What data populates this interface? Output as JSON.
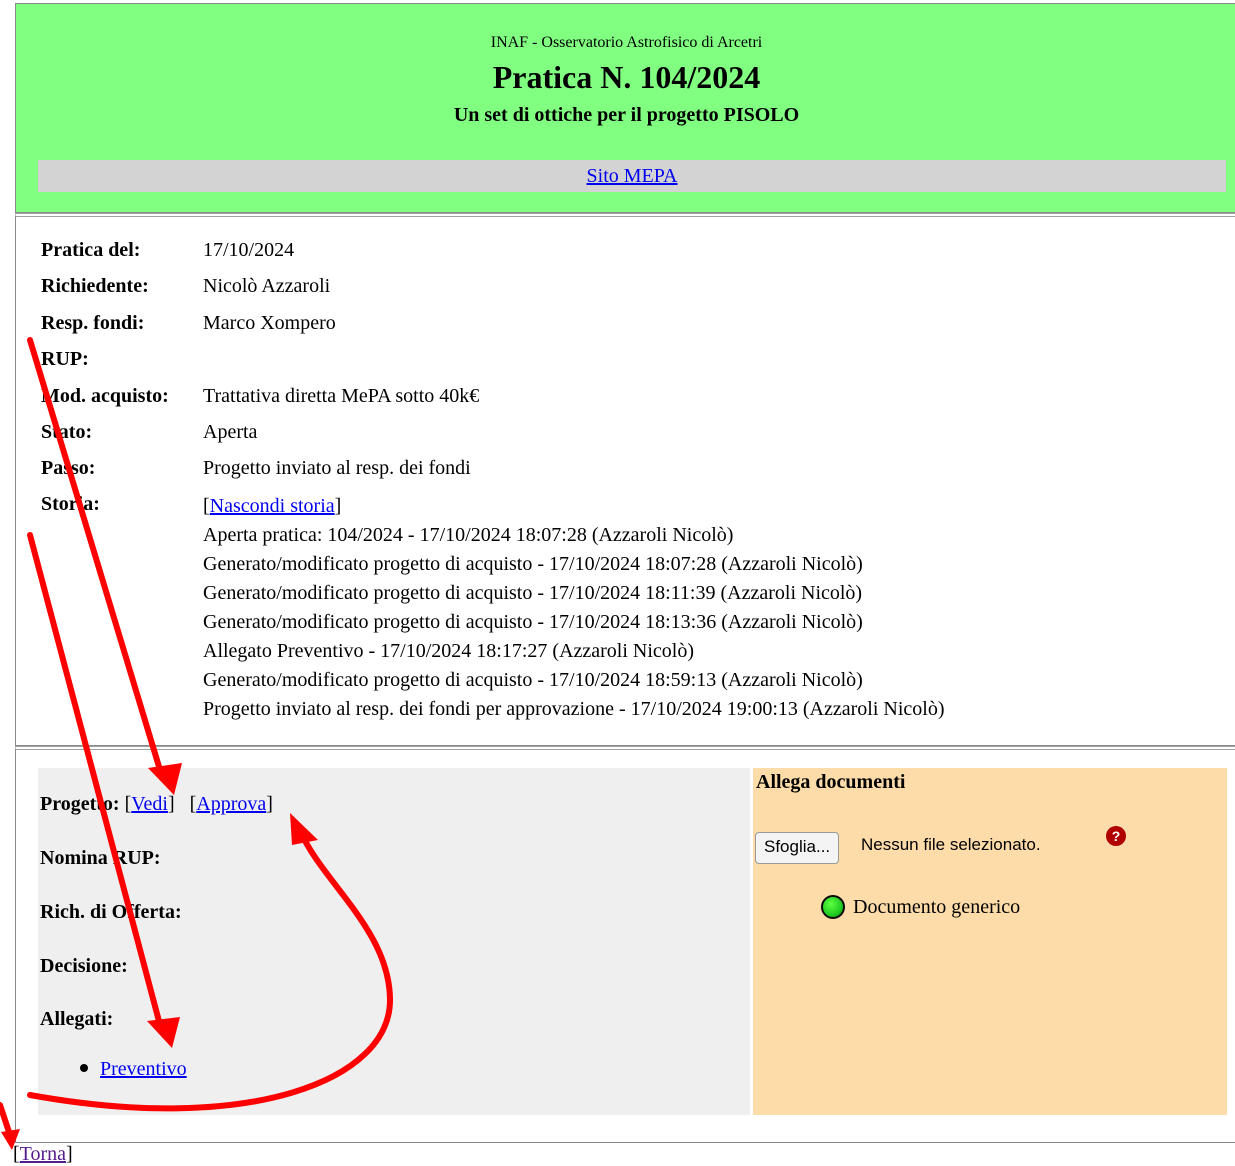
{
  "header": {
    "institution": "INAF - Osservatorio Astrofisico di Arcetri",
    "title": "Pratica N. 104/2024",
    "subtitle": "Un set di ottiche per il progetto PISOLO",
    "mepa_link": "Sito MEPA"
  },
  "info": {
    "fields": [
      {
        "label": "Pratica del:",
        "value": "17/10/2024"
      },
      {
        "label": "Richiedente:",
        "value": "Nicolò Azzaroli"
      },
      {
        "label": "Resp. fondi:",
        "value": "Marco Xompero"
      },
      {
        "label": "RUP:",
        "value": ""
      },
      {
        "label": "Mod. acquisto:",
        "value": "Trattativa diretta MePA sotto 40k€"
      },
      {
        "label": "Stato:",
        "value": "Aperta"
      },
      {
        "label": "Passo:",
        "value": "Progetto inviato al resp. dei fondi"
      },
      {
        "label": "Storia:",
        "value": ""
      }
    ],
    "history_toggle": "Nascondi storia",
    "history": [
      "Aperta pratica: 104/2024 - 17/10/2024 18:07:28 (Azzaroli Nicolò)",
      "Generato/modificato progetto di acquisto - 17/10/2024 18:07:28 (Azzaroli Nicolò)",
      "Generato/modificato progetto di acquisto - 17/10/2024 18:11:39 (Azzaroli Nicolò)",
      "Generato/modificato progetto di acquisto - 17/10/2024 18:13:36 (Azzaroli Nicolò)",
      "Allegato Preventivo - 17/10/2024 18:17:27 (Azzaroli Nicolò)",
      "Generato/modificato progetto di acquisto - 17/10/2024 18:59:13 (Azzaroli Nicolò)",
      "Progetto inviato al resp. dei fondi per approvazione - 17/10/2024 19:00:13 (Azzaroli Nicolò)"
    ]
  },
  "actions": {
    "progetto_label": "Progetto:",
    "vedi": "Vedi",
    "approva": "Approva",
    "nomina_rup": "Nomina RUP:",
    "rich_offerta": "Rich. di Offerta:",
    "decisione": "Decisione:",
    "allegati": "Allegati:",
    "allegati_items": [
      "Preventivo"
    ]
  },
  "attach": {
    "title": "Allega documenti",
    "browse_button": "Sfoglia...",
    "no_file": "Nessun file selezionato.",
    "help_icon": "question-circle-icon",
    "doc_type": "Documento generico"
  },
  "footer": {
    "torna": "Torna"
  },
  "colors": {
    "header_bg": "#80ff80",
    "mepa_bar": "#d3d3d3",
    "left_panel": "#efefef",
    "right_panel": "#fedcaa",
    "annotation_arrows": "#ff0000"
  }
}
